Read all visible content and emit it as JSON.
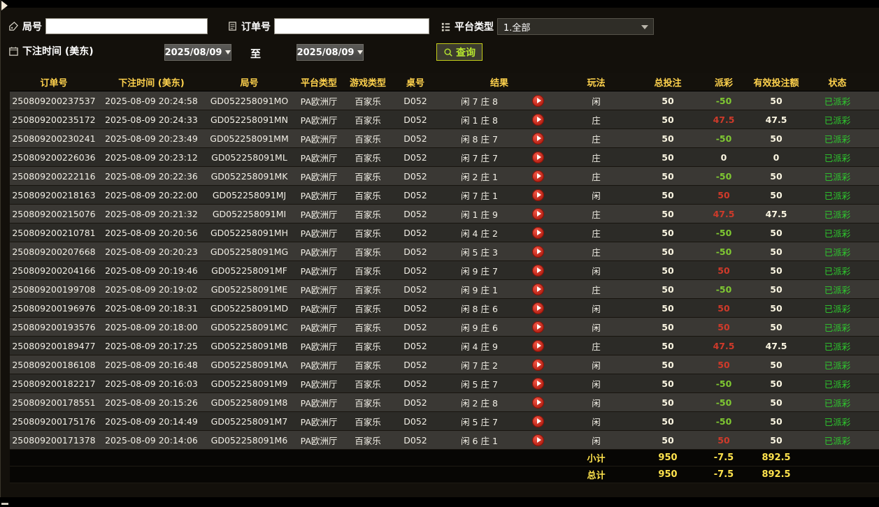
{
  "filters": {
    "round": {
      "label": "局号",
      "value": ""
    },
    "order": {
      "label": "订单号",
      "value": ""
    },
    "platform": {
      "label": "平台类型",
      "value": "1.全部"
    },
    "bet_time": {
      "label": "下注时间 (美东)",
      "from": "2025/08/09",
      "to_label": "至",
      "to": "2025/08/09"
    },
    "query": {
      "label": "查询"
    }
  },
  "table": {
    "headers": [
      "订单号",
      "下注时间 (美东)",
      "局号",
      "平台类型",
      "游戏类型",
      "桌号",
      "结果",
      "玩法",
      "总投注",
      "派彩",
      "有效投注额",
      "状态"
    ],
    "rows": [
      {
        "order": "250809200237537",
        "time": "2025-08-09 20:24:58",
        "round": "GD052258091MO",
        "platform": "PA欧洲厅",
        "game": "百家乐",
        "table_no": "D052",
        "result": "闲 7 庄 8",
        "play": "闲",
        "total": "50",
        "payout": "-50",
        "valid": "50",
        "status": "已派彩"
      },
      {
        "order": "250809200235172",
        "time": "2025-08-09 20:24:33",
        "round": "GD052258091MN",
        "platform": "PA欧洲厅",
        "game": "百家乐",
        "table_no": "D052",
        "result": "闲 1 庄 8",
        "play": "庄",
        "total": "50",
        "payout": "47.5",
        "valid": "47.5",
        "status": "已派彩"
      },
      {
        "order": "250809200230241",
        "time": "2025-08-09 20:23:49",
        "round": "GD052258091MM",
        "platform": "PA欧洲厅",
        "game": "百家乐",
        "table_no": "D052",
        "result": "闲 8 庄 7",
        "play": "庄",
        "total": "50",
        "payout": "-50",
        "valid": "50",
        "status": "已派彩"
      },
      {
        "order": "250809200226036",
        "time": "2025-08-09 20:23:12",
        "round": "GD052258091ML",
        "platform": "PA欧洲厅",
        "game": "百家乐",
        "table_no": "D052",
        "result": "闲 7 庄 7",
        "play": "庄",
        "total": "50",
        "payout": "0",
        "valid": "0",
        "status": "已派彩"
      },
      {
        "order": "250809200222116",
        "time": "2025-08-09 20:22:36",
        "round": "GD052258091MK",
        "platform": "PA欧洲厅",
        "game": "百家乐",
        "table_no": "D052",
        "result": "闲 2 庄 1",
        "play": "庄",
        "total": "50",
        "payout": "-50",
        "valid": "50",
        "status": "已派彩"
      },
      {
        "order": "250809200218163",
        "time": "2025-08-09 20:22:00",
        "round": "GD052258091MJ",
        "platform": "PA欧洲厅",
        "game": "百家乐",
        "table_no": "D052",
        "result": "闲 7 庄 1",
        "play": "闲",
        "total": "50",
        "payout": "50",
        "valid": "50",
        "status": "已派彩"
      },
      {
        "order": "250809200215076",
        "time": "2025-08-09 20:21:32",
        "round": "GD052258091MI",
        "platform": "PA欧洲厅",
        "game": "百家乐",
        "table_no": "D052",
        "result": "闲 1 庄 9",
        "play": "庄",
        "total": "50",
        "payout": "47.5",
        "valid": "47.5",
        "status": "已派彩"
      },
      {
        "order": "250809200210781",
        "time": "2025-08-09 20:20:56",
        "round": "GD052258091MH",
        "platform": "PA欧洲厅",
        "game": "百家乐",
        "table_no": "D052",
        "result": "闲 4 庄 2",
        "play": "庄",
        "total": "50",
        "payout": "-50",
        "valid": "50",
        "status": "已派彩"
      },
      {
        "order": "250809200207668",
        "time": "2025-08-09 20:20:23",
        "round": "GD052258091MG",
        "platform": "PA欧洲厅",
        "game": "百家乐",
        "table_no": "D052",
        "result": "闲 5 庄 3",
        "play": "庄",
        "total": "50",
        "payout": "-50",
        "valid": "50",
        "status": "已派彩"
      },
      {
        "order": "250809200204166",
        "time": "2025-08-09 20:19:46",
        "round": "GD052258091MF",
        "platform": "PA欧洲厅",
        "game": "百家乐",
        "table_no": "D052",
        "result": "闲 9 庄 7",
        "play": "闲",
        "total": "50",
        "payout": "50",
        "valid": "50",
        "status": "已派彩"
      },
      {
        "order": "250809200199708",
        "time": "2025-08-09 20:19:02",
        "round": "GD052258091ME",
        "platform": "PA欧洲厅",
        "game": "百家乐",
        "table_no": "D052",
        "result": "闲 9 庄 1",
        "play": "庄",
        "total": "50",
        "payout": "-50",
        "valid": "50",
        "status": "已派彩"
      },
      {
        "order": "250809200196976",
        "time": "2025-08-09 20:18:31",
        "round": "GD052258091MD",
        "platform": "PA欧洲厅",
        "game": "百家乐",
        "table_no": "D052",
        "result": "闲 8 庄 6",
        "play": "闲",
        "total": "50",
        "payout": "50",
        "valid": "50",
        "status": "已派彩"
      },
      {
        "order": "250809200193576",
        "time": "2025-08-09 20:18:00",
        "round": "GD052258091MC",
        "platform": "PA欧洲厅",
        "game": "百家乐",
        "table_no": "D052",
        "result": "闲 9 庄 6",
        "play": "闲",
        "total": "50",
        "payout": "50",
        "valid": "50",
        "status": "已派彩"
      },
      {
        "order": "250809200189477",
        "time": "2025-08-09 20:17:25",
        "round": "GD052258091MB",
        "platform": "PA欧洲厅",
        "game": "百家乐",
        "table_no": "D052",
        "result": "闲 4 庄 9",
        "play": "庄",
        "total": "50",
        "payout": "47.5",
        "valid": "47.5",
        "status": "已派彩"
      },
      {
        "order": "250809200186108",
        "time": "2025-08-09 20:16:48",
        "round": "GD052258091MA",
        "platform": "PA欧洲厅",
        "game": "百家乐",
        "table_no": "D052",
        "result": "闲 7 庄 2",
        "play": "闲",
        "total": "50",
        "payout": "50",
        "valid": "50",
        "status": "已派彩"
      },
      {
        "order": "250809200182217",
        "time": "2025-08-09 20:16:03",
        "round": "GD052258091M9",
        "platform": "PA欧洲厅",
        "game": "百家乐",
        "table_no": "D052",
        "result": "闲 5 庄 7",
        "play": "闲",
        "total": "50",
        "payout": "-50",
        "valid": "50",
        "status": "已派彩"
      },
      {
        "order": "250809200178551",
        "time": "2025-08-09 20:15:26",
        "round": "GD052258091M8",
        "platform": "PA欧洲厅",
        "game": "百家乐",
        "table_no": "D052",
        "result": "闲 2 庄 8",
        "play": "闲",
        "total": "50",
        "payout": "-50",
        "valid": "50",
        "status": "已派彩"
      },
      {
        "order": "250809200175176",
        "time": "2025-08-09 20:14:49",
        "round": "GD052258091M7",
        "platform": "PA欧洲厅",
        "game": "百家乐",
        "table_no": "D052",
        "result": "闲 5 庄 7",
        "play": "闲",
        "total": "50",
        "payout": "-50",
        "valid": "50",
        "status": "已派彩"
      },
      {
        "order": "250809200171378",
        "time": "2025-08-09 20:14:06",
        "round": "GD052258091M6",
        "platform": "PA欧洲厅",
        "game": "百家乐",
        "table_no": "D052",
        "result": "闲 6 庄 1",
        "play": "闲",
        "total": "50",
        "payout": "50",
        "valid": "50",
        "status": "已派彩"
      }
    ],
    "subtotal": {
      "label": "小计",
      "total": "950",
      "payout": "-7.5",
      "valid": "892.5"
    },
    "grand_total": {
      "label": "总计",
      "total": "950",
      "payout": "-7.5",
      "valid": "892.5"
    }
  },
  "colors": {
    "payout_positive": "#cf3a2a",
    "payout_negative": "#7fc832",
    "status_paid": "#2ecc2e",
    "header_text": "#ffd24d",
    "totals_text": "#ffe34d",
    "query_text": "#b7e62e"
  }
}
